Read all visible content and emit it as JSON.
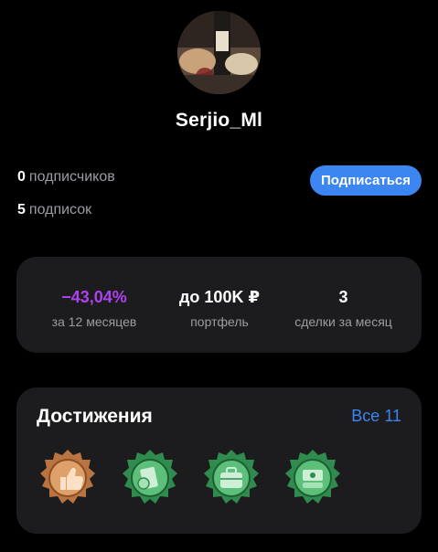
{
  "profile": {
    "username": "Serjio_Ml",
    "followers_count": "0",
    "followers_label": "подписчиков",
    "following_count": "5",
    "following_label": "подписок",
    "follow_button": "Подписаться"
  },
  "stats": [
    {
      "value": "−43,04%",
      "label": "за 12 месяцев",
      "color": "#b041ee"
    },
    {
      "value": "до 100K ₽",
      "label": "портфель"
    },
    {
      "value": "3",
      "label": "сделки за месяц"
    }
  ],
  "achievements": {
    "title": "Достижения",
    "all_link": "Все 11",
    "badges": [
      {
        "icon": "thumbs-up-icon",
        "tier": "bronze"
      },
      {
        "icon": "money-icon",
        "tier": "green"
      },
      {
        "icon": "briefcase-icon",
        "tier": "green"
      },
      {
        "icon": "cash-stack-icon",
        "tier": "green"
      }
    ]
  }
}
